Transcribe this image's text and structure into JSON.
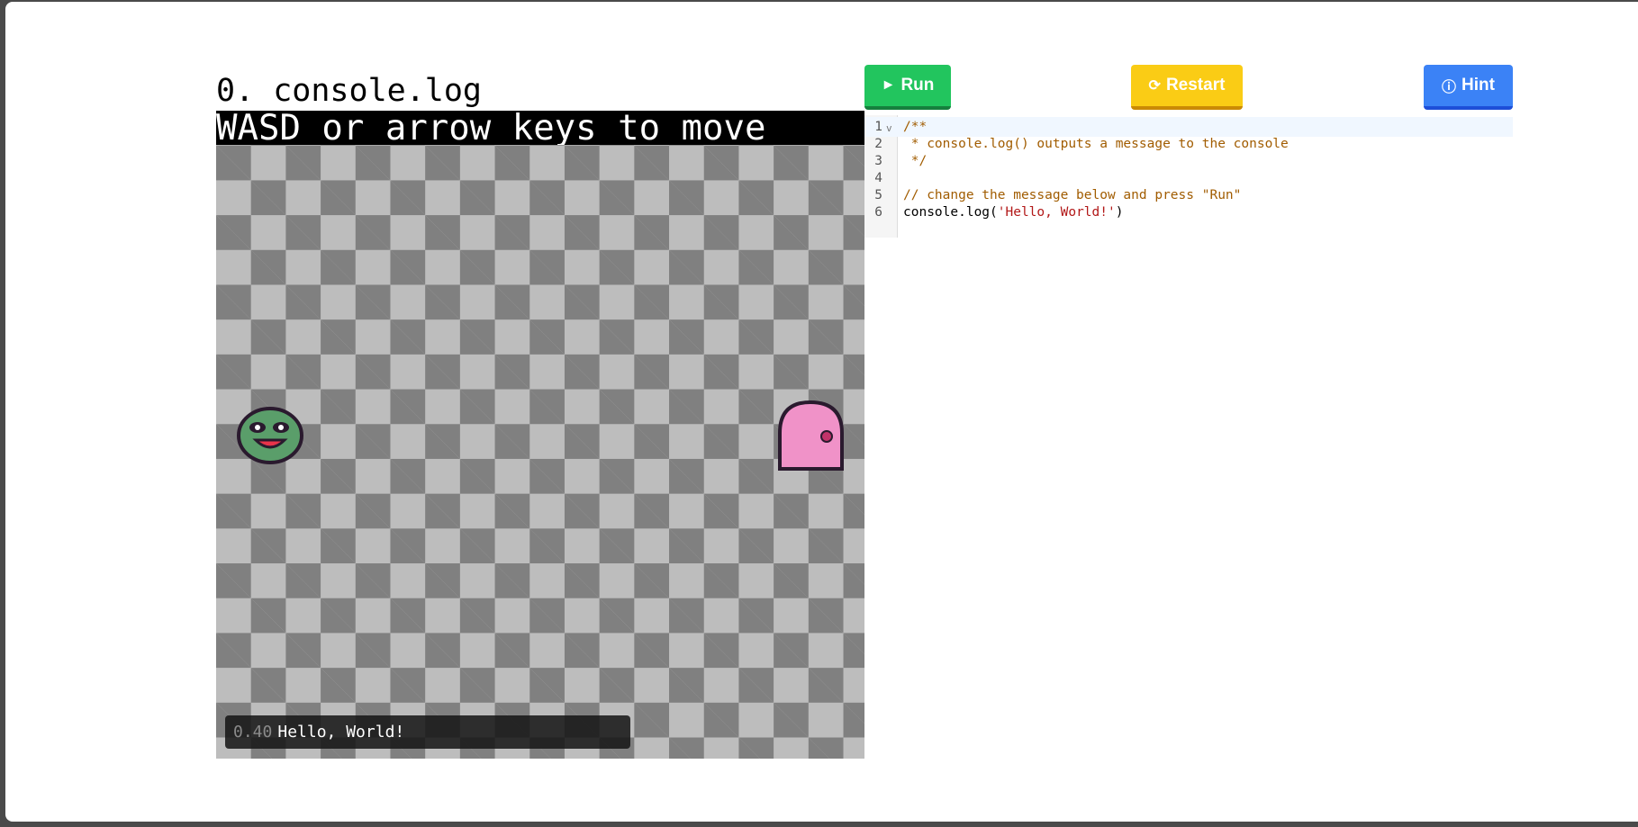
{
  "level": {
    "title": "0. console.log"
  },
  "game": {
    "instructions": "WASD or arrow keys to move",
    "console": {
      "timestamp": "0.40",
      "message": "Hello, World!"
    },
    "colors": {
      "light_tile": "#bdbdbd",
      "dark_tile": "#808080",
      "player": "#5a9e6a",
      "door": "#f092c8"
    }
  },
  "toolbar": {
    "run_label": "Run",
    "run_icon": "play-icon",
    "restart_label": "Restart",
    "restart_icon": "refresh-icon",
    "hint_label": "Hint",
    "hint_icon": "info-icon"
  },
  "editor": {
    "lines": [
      {
        "num": "1",
        "parts": [
          {
            "t": "/**",
            "c": "cm"
          }
        ],
        "fold": true,
        "active": true
      },
      {
        "num": "2",
        "parts": [
          {
            "t": " * console.log() outputs a message to the console",
            "c": "cm"
          }
        ]
      },
      {
        "num": "3",
        "parts": [
          {
            "t": " */",
            "c": "cm"
          }
        ]
      },
      {
        "num": "4",
        "parts": []
      },
      {
        "num": "5",
        "parts": [
          {
            "t": "// change the message below and press \"Run\"",
            "c": "cm"
          }
        ]
      },
      {
        "num": "6",
        "parts": [
          {
            "t": "console.log(",
            "c": ""
          },
          {
            "t": "'Hello, World!'",
            "c": "str"
          },
          {
            "t": ")",
            "c": ""
          }
        ]
      }
    ]
  }
}
